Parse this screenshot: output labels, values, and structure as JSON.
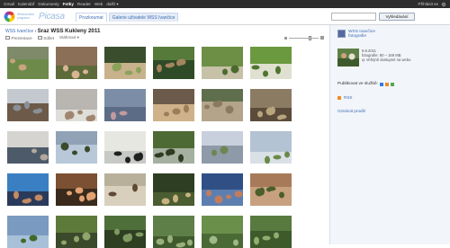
{
  "gbar": {
    "nav": [
      "Gmail",
      "Kalendář",
      "Dokumenty",
      "Fotky",
      "Reader",
      "Web",
      "další ▾"
    ],
    "active_index": 3,
    "signin": "Přihlásit se"
  },
  "header": {
    "logo_tag": "Webová alba programu",
    "logo_word": "Picasa",
    "tabs": [
      "Prozkoumat",
      "Galerie uživatele WSS Ivančice"
    ],
    "selected_tab": 1,
    "search_placeholder": "",
    "search_button": "Vyhledávání"
  },
  "main": {
    "crumb_link": "WSS Ivančice",
    "crumb_sep": " › ",
    "album_title": "Sraz WSS Kukleny 2011",
    "toolbar": {
      "slideshow": "Prezentace",
      "edit": "Sdílet",
      "more": "Stáhnout ▾"
    },
    "zoom_level": 0.68,
    "photos": [
      [
        "#7f8a6a",
        "#c6a47f",
        "#6d8a4a"
      ],
      [
        "#8b6f56",
        "#d9b493",
        "#5d6b3a"
      ],
      [
        "#3a4d2d",
        "#8aa35a",
        "#c8b28c"
      ],
      [
        "#557a3a",
        "#a4855f",
        "#2f4a26"
      ],
      [
        "#6c8f45",
        "#4b6a2e",
        "#c7c1a8"
      ],
      [
        "#6b9940",
        "#4f7430",
        "#dfe0d0"
      ],
      [
        "#c4c9cf",
        "#8a9098",
        "#6d5a48"
      ],
      [
        "#b9b6b1",
        "#a08670",
        "#e0ded8"
      ],
      [
        "#7c8ea7",
        "#c29aa0",
        "#5d6c86"
      ],
      [
        "#6c5b4b",
        "#9b7d5c",
        "#cfb18a"
      ],
      [
        "#5f6f4d",
        "#8a7a60",
        "#b3a48a"
      ],
      [
        "#8c7b63",
        "#b8a47d",
        "#5a4b3a"
      ],
      [
        "#d6d4d0",
        "#b2a89c",
        "#4d5a6a"
      ],
      [
        "#8fa2b6",
        "#3a4a2c",
        "#b8c8d8"
      ],
      [
        "#e7e7e2",
        "#202020",
        "#c7c9c6"
      ],
      [
        "#4e6a34",
        "#2e3c22",
        "#a5b0a0"
      ],
      [
        "#c7d0dc",
        "#6f8550",
        "#8e9aa8"
      ],
      [
        "#b4c3d3",
        "#6b8a48",
        "#d9e0e6"
      ],
      [
        "#3a7fc2",
        "#c28b64",
        "#2a3a5a"
      ],
      [
        "#7c5032",
        "#e3a272",
        "#3a2a1c"
      ],
      [
        "#b9b09c",
        "#5e4a35",
        "#d8d0bc"
      ],
      [
        "#2d3e22",
        "#c9b282",
        "#4b5d31"
      ],
      [
        "#2f4f85",
        "#c27c5e",
        "#5d7fb0"
      ],
      [
        "#a77a5a",
        "#4a5e2e",
        "#c7a17f"
      ],
      [
        "#7a9bbf",
        "#3f6a2c",
        "#a8c0d8"
      ],
      [
        "#5d7a3a",
        "#8ea56c",
        "#3a4a2a"
      ],
      [
        "#4f6f3a",
        "#7e9a60",
        "#2e3f22"
      ],
      [
        "#5f7f48",
        "#9ab07a",
        "#3e5a2e"
      ],
      [
        "#6a8f4a",
        "#9fb98a",
        "#4a6a35"
      ],
      [
        "#587a40",
        "#8fae6f",
        "#3d5a2b"
      ]
    ]
  },
  "side": {
    "owner_name": "WSS Ivančice",
    "owner_sub": "fotografie",
    "album_date": "9.8.2011",
    "album_count": "fotografie: 80 – 169 MB",
    "album_access": "Veřejně dostupné na webu",
    "publish_label": "Publikovat ve službě:",
    "rss": "RSS",
    "report": "Oznámit prodlil"
  },
  "colors": {
    "link": "#3b6eb4",
    "gbar": "#2d2d2d",
    "side_bg": "#f2f5fa"
  }
}
